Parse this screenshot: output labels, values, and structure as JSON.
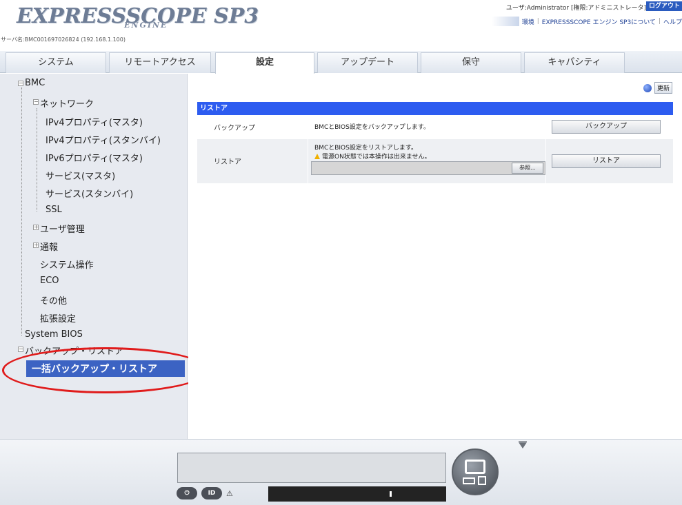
{
  "header": {
    "logo_main": "EXPRESSSCOPE SP3",
    "logo_sub": "ENGINE",
    "server_name": "サーバ名:BMC001697026824 (192.168.1.100)",
    "user_info": "ユーザ:Administrator [権限:アドミニストレータ]",
    "logout_label": "ログアウト",
    "link_env": "環境",
    "link_about": "EXPRESSSCOPE エンジン SP3について",
    "link_help": "ヘルプ"
  },
  "tabs": [
    {
      "label": "システム"
    },
    {
      "label": "リモートアクセス"
    },
    {
      "label": "設定"
    },
    {
      "label": "アップデート"
    },
    {
      "label": "保守"
    },
    {
      "label": "キャパシティ"
    }
  ],
  "sidebar": {
    "bmc": "BMC",
    "network": "ネットワーク",
    "ipv4_master": "IPv4プロパティ(マスタ)",
    "ipv4_standby": "IPv4プロパティ(スタンバイ)",
    "ipv6_master": "IPv6プロパティ(マスタ)",
    "service_master": "サービス(マスタ)",
    "service_standby": "サービス(スタンバイ)",
    "ssl": "SSL",
    "user_mgmt": "ユーザ管理",
    "notification": "通報",
    "system_op": "システム操作",
    "eco": "ECO",
    "other": "その他",
    "extended": "拡張設定",
    "system_bios": "System BIOS",
    "backup_restore": "バックアップ・リストア",
    "bulk_backup_restore": "一括バックアップ・リストア"
  },
  "main": {
    "refresh_label": "更新",
    "section_title": "リストア",
    "backup_row": {
      "label": "バックアップ",
      "description": "BMCとBIOS設定をバックアップします。",
      "button": "バックアップ"
    },
    "restore_row": {
      "label": "リストア",
      "description": "BMCとBIOS設定をリストアします。",
      "warning": "電源ON状態では本操作は出来ません。",
      "browse": "参照...",
      "button": "リストア"
    }
  },
  "bottom": {
    "power_icon": "power-icon",
    "id_label": "ID",
    "warn_symbol": "⚠"
  },
  "colors": {
    "accent_blue": "#2d5cf0",
    "selected_blue": "#3c63c3",
    "highlight_red": "#e01b1b"
  }
}
